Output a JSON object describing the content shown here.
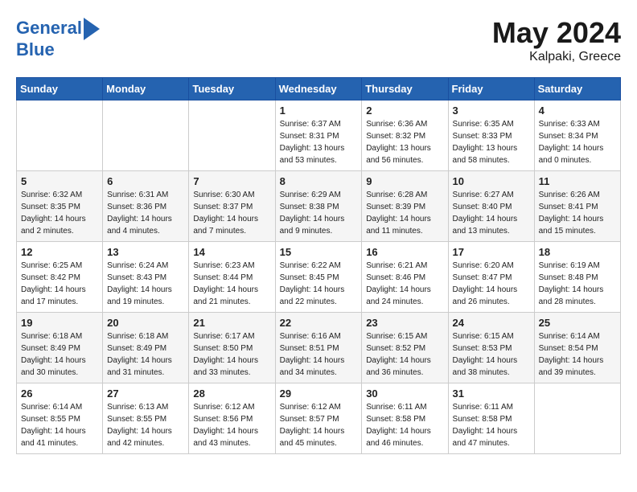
{
  "header": {
    "logo_line1": "General",
    "logo_line2": "Blue",
    "main_title": "May 2024",
    "subtitle": "Kalpaki, Greece"
  },
  "days_of_week": [
    "Sunday",
    "Monday",
    "Tuesday",
    "Wednesday",
    "Thursday",
    "Friday",
    "Saturday"
  ],
  "weeks": [
    [
      {
        "day": "",
        "info": ""
      },
      {
        "day": "",
        "info": ""
      },
      {
        "day": "",
        "info": ""
      },
      {
        "day": "1",
        "info": "Sunrise: 6:37 AM\nSunset: 8:31 PM\nDaylight: 13 hours\nand 53 minutes."
      },
      {
        "day": "2",
        "info": "Sunrise: 6:36 AM\nSunset: 8:32 PM\nDaylight: 13 hours\nand 56 minutes."
      },
      {
        "day": "3",
        "info": "Sunrise: 6:35 AM\nSunset: 8:33 PM\nDaylight: 13 hours\nand 58 minutes."
      },
      {
        "day": "4",
        "info": "Sunrise: 6:33 AM\nSunset: 8:34 PM\nDaylight: 14 hours\nand 0 minutes."
      }
    ],
    [
      {
        "day": "5",
        "info": "Sunrise: 6:32 AM\nSunset: 8:35 PM\nDaylight: 14 hours\nand 2 minutes."
      },
      {
        "day": "6",
        "info": "Sunrise: 6:31 AM\nSunset: 8:36 PM\nDaylight: 14 hours\nand 4 minutes."
      },
      {
        "day": "7",
        "info": "Sunrise: 6:30 AM\nSunset: 8:37 PM\nDaylight: 14 hours\nand 7 minutes."
      },
      {
        "day": "8",
        "info": "Sunrise: 6:29 AM\nSunset: 8:38 PM\nDaylight: 14 hours\nand 9 minutes."
      },
      {
        "day": "9",
        "info": "Sunrise: 6:28 AM\nSunset: 8:39 PM\nDaylight: 14 hours\nand 11 minutes."
      },
      {
        "day": "10",
        "info": "Sunrise: 6:27 AM\nSunset: 8:40 PM\nDaylight: 14 hours\nand 13 minutes."
      },
      {
        "day": "11",
        "info": "Sunrise: 6:26 AM\nSunset: 8:41 PM\nDaylight: 14 hours\nand 15 minutes."
      }
    ],
    [
      {
        "day": "12",
        "info": "Sunrise: 6:25 AM\nSunset: 8:42 PM\nDaylight: 14 hours\nand 17 minutes."
      },
      {
        "day": "13",
        "info": "Sunrise: 6:24 AM\nSunset: 8:43 PM\nDaylight: 14 hours\nand 19 minutes."
      },
      {
        "day": "14",
        "info": "Sunrise: 6:23 AM\nSunset: 8:44 PM\nDaylight: 14 hours\nand 21 minutes."
      },
      {
        "day": "15",
        "info": "Sunrise: 6:22 AM\nSunset: 8:45 PM\nDaylight: 14 hours\nand 22 minutes."
      },
      {
        "day": "16",
        "info": "Sunrise: 6:21 AM\nSunset: 8:46 PM\nDaylight: 14 hours\nand 24 minutes."
      },
      {
        "day": "17",
        "info": "Sunrise: 6:20 AM\nSunset: 8:47 PM\nDaylight: 14 hours\nand 26 minutes."
      },
      {
        "day": "18",
        "info": "Sunrise: 6:19 AM\nSunset: 8:48 PM\nDaylight: 14 hours\nand 28 minutes."
      }
    ],
    [
      {
        "day": "19",
        "info": "Sunrise: 6:18 AM\nSunset: 8:49 PM\nDaylight: 14 hours\nand 30 minutes."
      },
      {
        "day": "20",
        "info": "Sunrise: 6:18 AM\nSunset: 8:49 PM\nDaylight: 14 hours\nand 31 minutes."
      },
      {
        "day": "21",
        "info": "Sunrise: 6:17 AM\nSunset: 8:50 PM\nDaylight: 14 hours\nand 33 minutes."
      },
      {
        "day": "22",
        "info": "Sunrise: 6:16 AM\nSunset: 8:51 PM\nDaylight: 14 hours\nand 34 minutes."
      },
      {
        "day": "23",
        "info": "Sunrise: 6:15 AM\nSunset: 8:52 PM\nDaylight: 14 hours\nand 36 minutes."
      },
      {
        "day": "24",
        "info": "Sunrise: 6:15 AM\nSunset: 8:53 PM\nDaylight: 14 hours\nand 38 minutes."
      },
      {
        "day": "25",
        "info": "Sunrise: 6:14 AM\nSunset: 8:54 PM\nDaylight: 14 hours\nand 39 minutes."
      }
    ],
    [
      {
        "day": "26",
        "info": "Sunrise: 6:14 AM\nSunset: 8:55 PM\nDaylight: 14 hours\nand 41 minutes."
      },
      {
        "day": "27",
        "info": "Sunrise: 6:13 AM\nSunset: 8:55 PM\nDaylight: 14 hours\nand 42 minutes."
      },
      {
        "day": "28",
        "info": "Sunrise: 6:12 AM\nSunset: 8:56 PM\nDaylight: 14 hours\nand 43 minutes."
      },
      {
        "day": "29",
        "info": "Sunrise: 6:12 AM\nSunset: 8:57 PM\nDaylight: 14 hours\nand 45 minutes."
      },
      {
        "day": "30",
        "info": "Sunrise: 6:11 AM\nSunset: 8:58 PM\nDaylight: 14 hours\nand 46 minutes."
      },
      {
        "day": "31",
        "info": "Sunrise: 6:11 AM\nSunset: 8:58 PM\nDaylight: 14 hours\nand 47 minutes."
      },
      {
        "day": "",
        "info": ""
      }
    ]
  ]
}
